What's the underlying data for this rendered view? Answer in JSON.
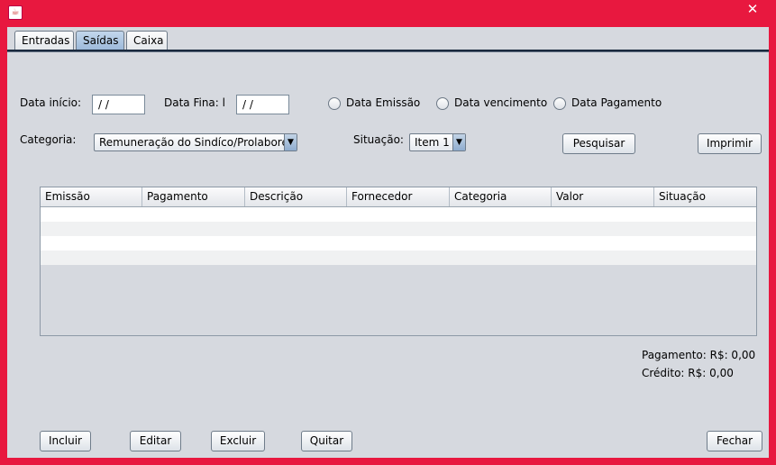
{
  "window": {
    "close_glyph": "✕",
    "icon": "java-app-icon"
  },
  "tabs": [
    {
      "label": "Entradas",
      "active": false
    },
    {
      "label": "Saídas",
      "active": true
    },
    {
      "label": "Caixa",
      "active": false
    }
  ],
  "filters": {
    "data_inicio_label": "Data início:",
    "data_inicio_value": " / /",
    "data_fim_label": "Data Fina: l",
    "data_fim_value": " / /",
    "radios": [
      {
        "label": "Data Emissão",
        "checked": false
      },
      {
        "label": "Data vencimento",
        "checked": false
      },
      {
        "label": "Data Pagamento",
        "checked": false
      }
    ],
    "categoria_label": "Categoria:",
    "categoria_value": "Remuneração do Sindíco/Prolabore",
    "situacao_label": "Situação:",
    "situacao_value": "Item 1",
    "pesquisar_label": "Pesquisar",
    "imprimir_label": "Imprimir"
  },
  "table": {
    "columns": [
      "Emissão",
      "Pagamento",
      "Descrição",
      "Fornecedor",
      "Categoria",
      "Valor",
      "Situação"
    ],
    "rows": [
      [
        "",
        "",
        "",
        "",
        "",
        "",
        ""
      ],
      [
        "",
        "",
        "",
        "",
        "",
        "",
        ""
      ],
      [
        "",
        "",
        "",
        "",
        "",
        "",
        ""
      ],
      [
        "",
        "",
        "",
        "",
        "",
        "",
        ""
      ]
    ]
  },
  "totals": {
    "pagamento": "Pagamento: R$: 0,00",
    "credito": "Crédito:  R$: 0,00"
  },
  "actions": {
    "incluir": "Incluir",
    "editar": "Editar",
    "excluir": "Excluir",
    "quitar": "Quitar",
    "fechar": "Fechar"
  },
  "colors": {
    "window_frame": "#e8183f",
    "panel": "#d6d9df",
    "active_tab": "#9bb8d9"
  }
}
